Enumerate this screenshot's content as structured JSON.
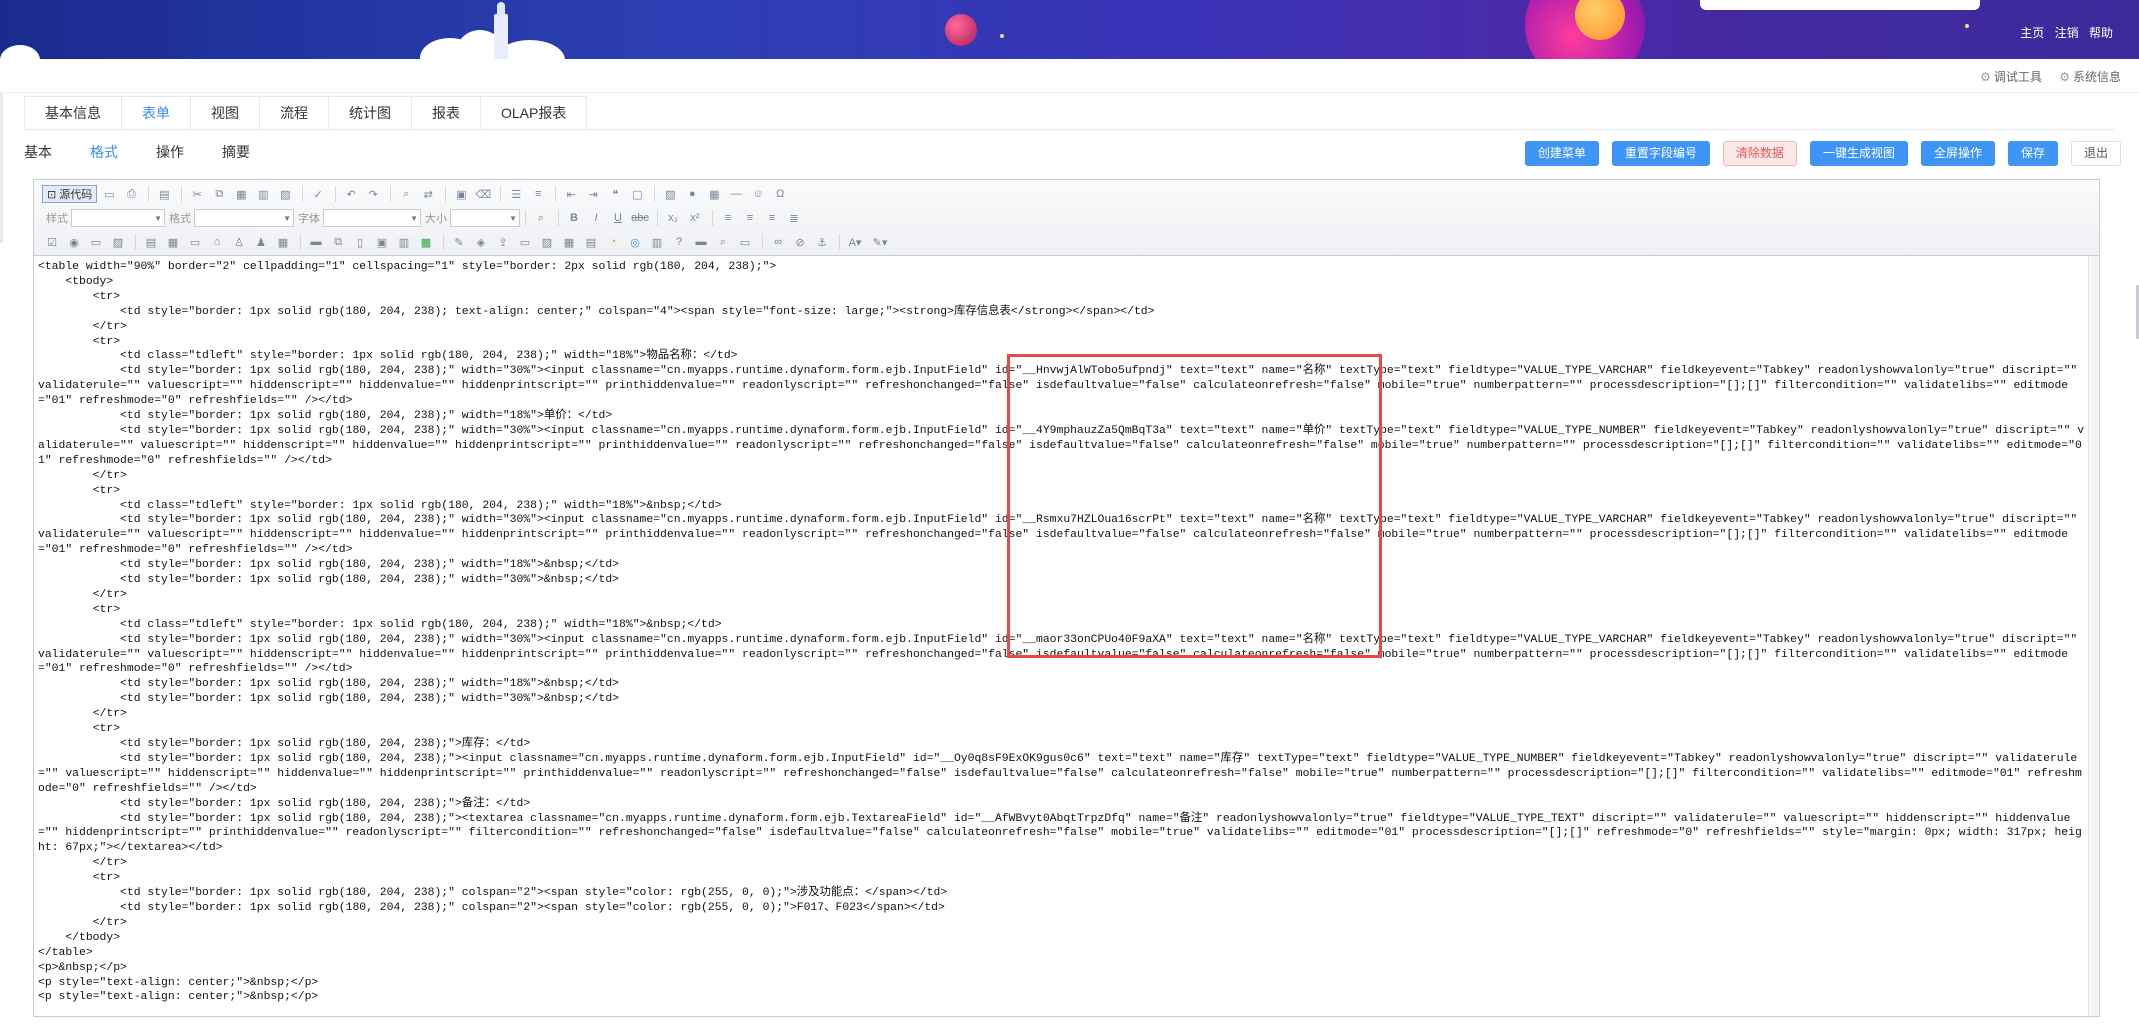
{
  "header": {
    "links": [
      "主页",
      "注销",
      "帮助"
    ]
  },
  "sysbar": {
    "debug_tool": "调试工具",
    "sys_info": "系统信息"
  },
  "main_tabs": [
    "基本信息",
    "表单",
    "视图",
    "流程",
    "统计图",
    "报表",
    "OLAP报表"
  ],
  "main_tab_active": "表单",
  "sub_tabs": [
    "基本",
    "格式",
    "操作",
    "摘要"
  ],
  "sub_tab_active": "格式",
  "actions": {
    "create_menu": "创建菜单",
    "reset_field_no": "重置字段编号",
    "clear_data": "清除数据",
    "gen_view": "一键生成视图",
    "full_screen": "全屏操作",
    "save": "保存",
    "exit": "退出"
  },
  "editor": {
    "source_btn": "源代码",
    "style_label": "样式",
    "format_label": "格式",
    "font_label": "字体",
    "size_label": "大小",
    "code": "<table width=\"90%\" border=\"2\" cellpadding=\"1\" cellspacing=\"1\" style=\"border: 2px solid rgb(180, 204, 238);\">\n    <tbody>\n        <tr>\n            <td style=\"border: 1px solid rgb(180, 204, 238); text-align: center;\" colspan=\"4\"><span style=\"font-size: large;\"><strong>库存信息表</strong></span></td>\n        </tr>\n        <tr>\n            <td class=\"tdleft\" style=\"border: 1px solid rgb(180, 204, 238);\" width=\"18%\">物品名称：</td>\n            <td style=\"border: 1px solid rgb(180, 204, 238);\" width=\"30%\"><input classname=\"cn.myapps.runtime.dynaform.form.ejb.InputField\" id=\"__HnvwjAlWTobo5ufpndj\" text=\"text\" name=\"名称\" textType=\"text\" fieldtype=\"VALUE_TYPE_VARCHAR\" fieldkeyevent=\"Tabkey\" readonlyshowvalonly=\"true\" discript=\"\" validaterule=\"\" valuescript=\"\" hiddenscript=\"\" hiddenvalue=\"\" hiddenprintscript=\"\" printhiddenvalue=\"\" readonlyscript=\"\" refreshonchanged=\"false\" isdefaultvalue=\"false\" calculateonrefresh=\"false\" mobile=\"true\" numberpattern=\"\" processdescription=\"[];[]\" filtercondition=\"\" validatelibs=\"\" editmode=\"01\" refreshmode=\"0\" refreshfields=\"\" /></td>\n            <td style=\"border: 1px solid rgb(180, 204, 238);\" width=\"18%\">单价：</td>\n            <td style=\"border: 1px solid rgb(180, 204, 238);\" width=\"30%\"><input classname=\"cn.myapps.runtime.dynaform.form.ejb.InputField\" id=\"__4Y9mphauzZa5QmBqT3a\" text=\"text\" name=\"单价\" textType=\"text\" fieldtype=\"VALUE_TYPE_NUMBER\" fieldkeyevent=\"Tabkey\" readonlyshowvalonly=\"true\" discript=\"\" validaterule=\"\" valuescript=\"\" hiddenscript=\"\" hiddenvalue=\"\" hiddenprintscript=\"\" printhiddenvalue=\"\" readonlyscript=\"\" refreshonchanged=\"false\" isdefaultvalue=\"false\" calculateonrefresh=\"false\" mobile=\"true\" numberpattern=\"\" processdescription=\"[];[]\" filtercondition=\"\" validatelibs=\"\" editmode=\"01\" refreshmode=\"0\" refreshfields=\"\" /></td>\n        </tr>\n        <tr>\n            <td class=\"tdleft\" style=\"border: 1px solid rgb(180, 204, 238);\" width=\"18%\">&nbsp;</td>\n            <td style=\"border: 1px solid rgb(180, 204, 238);\" width=\"30%\"><input classname=\"cn.myapps.runtime.dynaform.form.ejb.InputField\" id=\"__Rsmxu7HZLOua16scrPt\" text=\"text\" name=\"名称\" textType=\"text\" fieldtype=\"VALUE_TYPE_VARCHAR\" fieldkeyevent=\"Tabkey\" readonlyshowvalonly=\"true\" discript=\"\" validaterule=\"\" valuescript=\"\" hiddenscript=\"\" hiddenvalue=\"\" hiddenprintscript=\"\" printhiddenvalue=\"\" readonlyscript=\"\" refreshonchanged=\"false\" isdefaultvalue=\"false\" calculateonrefresh=\"false\" mobile=\"true\" numberpattern=\"\" processdescription=\"[];[]\" filtercondition=\"\" validatelibs=\"\" editmode=\"01\" refreshmode=\"0\" refreshfields=\"\" /></td>\n            <td style=\"border: 1px solid rgb(180, 204, 238);\" width=\"18%\">&nbsp;</td>\n            <td style=\"border: 1px solid rgb(180, 204, 238);\" width=\"30%\">&nbsp;</td>\n        </tr>\n        <tr>\n            <td class=\"tdleft\" style=\"border: 1px solid rgb(180, 204, 238);\" width=\"18%\">&nbsp;</td>\n            <td style=\"border: 1px solid rgb(180, 204, 238);\" width=\"30%\"><input classname=\"cn.myapps.runtime.dynaform.form.ejb.InputField\" id=\"__maor33onCPUo40F9aXA\" text=\"text\" name=\"名称\" textType=\"text\" fieldtype=\"VALUE_TYPE_VARCHAR\" fieldkeyevent=\"Tabkey\" readonlyshowvalonly=\"true\" discript=\"\" validaterule=\"\" valuescript=\"\" hiddenscript=\"\" hiddenvalue=\"\" hiddenprintscript=\"\" printhiddenvalue=\"\" readonlyscript=\"\" refreshonchanged=\"false\" isdefaultvalue=\"false\" calculateonrefresh=\"false\" mobile=\"true\" numberpattern=\"\" processdescription=\"[];[]\" filtercondition=\"\" validatelibs=\"\" editmode=\"01\" refreshmode=\"0\" refreshfields=\"\" /></td>\n            <td style=\"border: 1px solid rgb(180, 204, 238);\" width=\"18%\">&nbsp;</td>\n            <td style=\"border: 1px solid rgb(180, 204, 238);\" width=\"30%\">&nbsp;</td>\n        </tr>\n        <tr>\n            <td style=\"border: 1px solid rgb(180, 204, 238);\">库存：</td>\n            <td style=\"border: 1px solid rgb(180, 204, 238);\"><input classname=\"cn.myapps.runtime.dynaform.form.ejb.InputField\" id=\"__Oy0q8sF9ExOK9gus0c6\" text=\"text\" name=\"库存\" textType=\"text\" fieldtype=\"VALUE_TYPE_NUMBER\" fieldkeyevent=\"Tabkey\" readonlyshowvalonly=\"true\" discript=\"\" validaterule=\"\" valuescript=\"\" hiddenscript=\"\" hiddenvalue=\"\" hiddenprintscript=\"\" printhiddenvalue=\"\" readonlyscript=\"\" refreshonchanged=\"false\" isdefaultvalue=\"false\" calculateonrefresh=\"false\" mobile=\"true\" numberpattern=\"\" processdescription=\"[];[]\" filtercondition=\"\" validatelibs=\"\" editmode=\"01\" refreshmode=\"0\" refreshfields=\"\" /></td>\n            <td style=\"border: 1px solid rgb(180, 204, 238);\">备注：</td>\n            <td style=\"border: 1px solid rgb(180, 204, 238);\"><textarea classname=\"cn.myapps.runtime.dynaform.form.ejb.TextareaField\" id=\"__AfWBvyt0AbqtTrpzDfq\" name=\"备注\" readonlyshowvalonly=\"true\" fieldtype=\"VALUE_TYPE_TEXT\" discript=\"\" validaterule=\"\" valuescript=\"\" hiddenscript=\"\" hiddenvalue=\"\" hiddenprintscript=\"\" printhiddenvalue=\"\" readonlyscript=\"\" filtercondition=\"\" refreshonchanged=\"false\" isdefaultvalue=\"false\" calculateonrefresh=\"false\" mobile=\"true\" validatelibs=\"\" editmode=\"01\" processdescription=\"[];[]\" refreshmode=\"0\" refreshfields=\"\" style=\"margin: 0px; width: 317px; height: 67px;\"></textarea></td>\n        </tr>\n        <tr>\n            <td style=\"border: 1px solid rgb(180, 204, 238);\" colspan=\"2\"><span style=\"color: rgb(255, 0, 0);\">涉及功能点：</span></td>\n            <td style=\"border: 1px solid rgb(180, 204, 238);\" colspan=\"2\"><span style=\"color: rgb(255, 0, 0);\">F017、F023</span></td>\n        </tr>\n    </tbody>\n</table>\n<p>&nbsp;</p>\n<p style=\"text-align: center;\">&nbsp;</p>\n<p style=\"text-align: center;\">&nbsp;</p>"
  },
  "colors": {
    "accent": "#3e95f5",
    "highlight_box": "#e84a4a"
  }
}
